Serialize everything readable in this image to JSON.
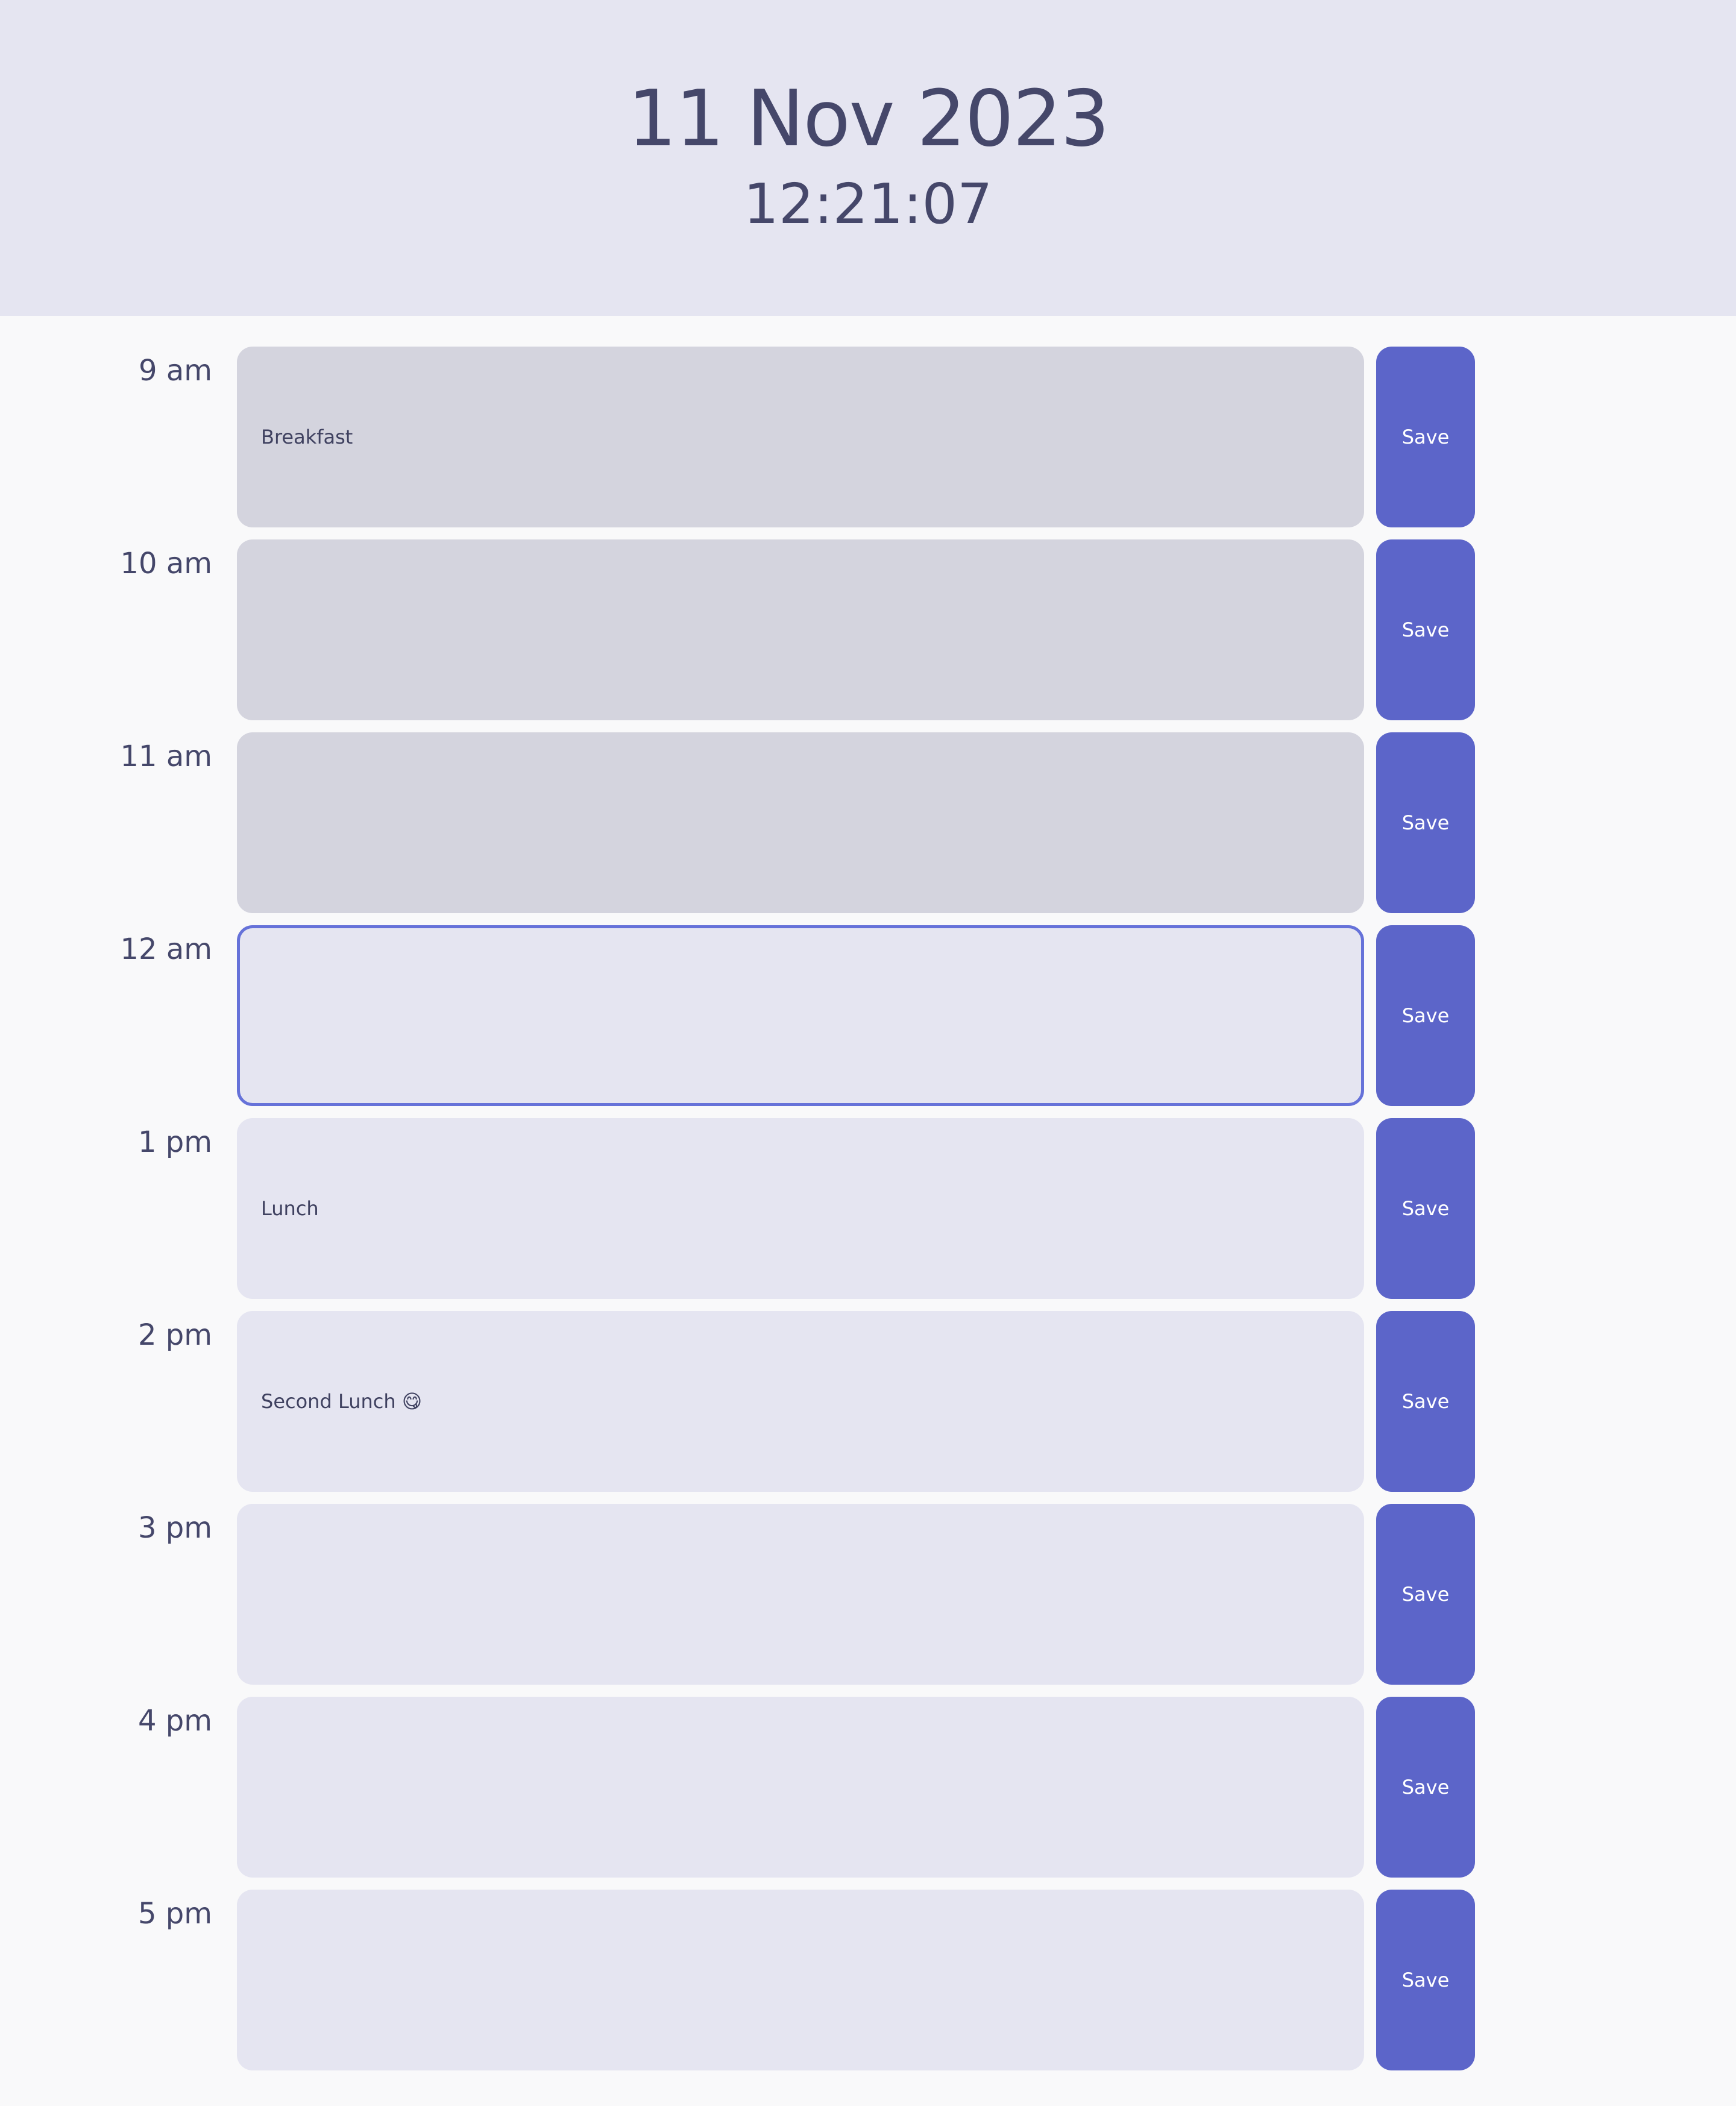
{
  "header": {
    "date": "11 Nov 2023",
    "time": "12:21:07"
  },
  "colors": {
    "past": "#d4d4de",
    "present_bg": "#e5e5f1",
    "present_border": "#6672d9",
    "future": "#e5e5f1",
    "save_button": "#5c65c9",
    "text": "#45476a",
    "header_bg": "#e5e5f1"
  },
  "slots": [
    {
      "hour": "9 am",
      "text": "Breakfast",
      "state": "past",
      "save_label": "Save"
    },
    {
      "hour": "10 am",
      "text": "",
      "state": "past",
      "save_label": "Save"
    },
    {
      "hour": "11 am",
      "text": "",
      "state": "past",
      "save_label": "Save"
    },
    {
      "hour": "12 am",
      "text": "",
      "state": "present",
      "save_label": "Save"
    },
    {
      "hour": "1 pm",
      "text": "Lunch",
      "state": "future",
      "save_label": "Save"
    },
    {
      "hour": "2 pm",
      "text": "Second Lunch 😋",
      "state": "future",
      "save_label": "Save"
    },
    {
      "hour": "3 pm",
      "text": "",
      "state": "future",
      "save_label": "Save"
    },
    {
      "hour": "4 pm",
      "text": "",
      "state": "future",
      "save_label": "Save"
    },
    {
      "hour": "5 pm",
      "text": "",
      "state": "future",
      "save_label": "Save"
    }
  ]
}
